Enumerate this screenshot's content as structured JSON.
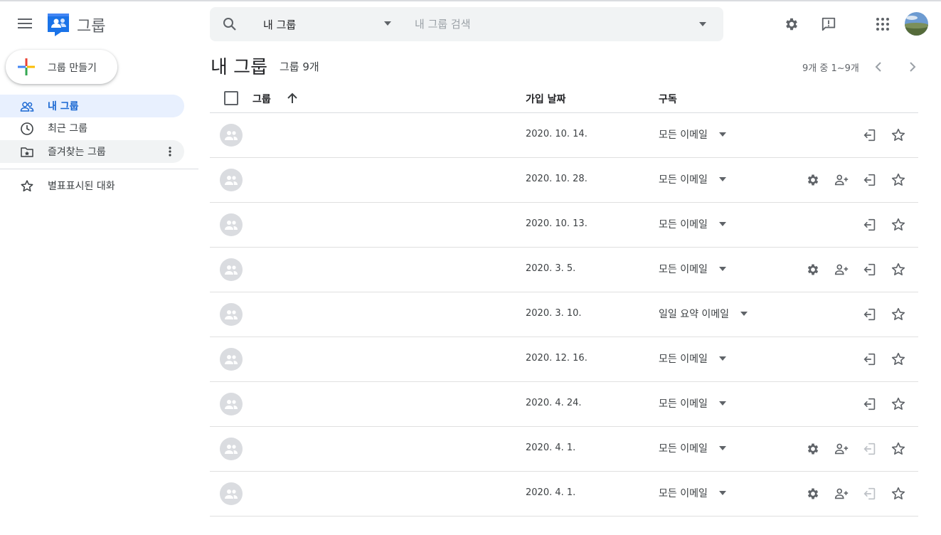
{
  "app": {
    "title": "그룹"
  },
  "search": {
    "scope": "내 그룹",
    "placeholder": "내 그룹 검색"
  },
  "sidebar": {
    "create_label": "그룹 만들기",
    "items": [
      {
        "label": "내 그룹"
      },
      {
        "label": "최근 그룹"
      },
      {
        "label": "즐겨찾는 그룹"
      },
      {
        "label": "별표표시된 대화"
      }
    ]
  },
  "main": {
    "title": "내 그룹",
    "count": "그룹 9개",
    "pager": "9개 중 1~9개",
    "columns": {
      "group": "그룹",
      "date": "가입 날짜",
      "subscription": "구독"
    },
    "rows": [
      {
        "date": "2020. 10. 14.",
        "subscription": "모든 이메일",
        "manage": false,
        "leave_enabled": true
      },
      {
        "date": "2020. 10. 28.",
        "subscription": "모든 이메일",
        "manage": true,
        "leave_enabled": true
      },
      {
        "date": "2020. 10. 13.",
        "subscription": "모든 이메일",
        "manage": false,
        "leave_enabled": true
      },
      {
        "date": "2020. 3. 5.",
        "subscription": "모든 이메일",
        "manage": true,
        "leave_enabled": true
      },
      {
        "date": "2020. 3. 10.",
        "subscription": "일일 요약 이메일",
        "manage": false,
        "leave_enabled": true
      },
      {
        "date": "2020. 12. 16.",
        "subscription": "모든 이메일",
        "manage": false,
        "leave_enabled": true
      },
      {
        "date": "2020. 4. 24.",
        "subscription": "모든 이메일",
        "manage": false,
        "leave_enabled": true
      },
      {
        "date": "2020. 4. 1.",
        "subscription": "모든 이메일",
        "manage": true,
        "leave_enabled": false
      },
      {
        "date": "2020. 4. 1.",
        "subscription": "모든 이메일",
        "manage": true,
        "leave_enabled": false
      }
    ]
  },
  "colors": {
    "accent": "#1967d2",
    "active_bg": "#e8f0fe",
    "icon": "#5f6368",
    "disabled_icon": "#bdc1c6"
  },
  "icons": [
    "menu-icon",
    "groups-logo",
    "search-icon",
    "settings-icon",
    "feedback-icon",
    "apps-icon",
    "avatar",
    "plus-icon",
    "people-icon",
    "clock-icon",
    "star-folder-icon",
    "more-vert-icon",
    "star-icon",
    "chevron-left-icon",
    "chevron-right-icon",
    "arrow-up-icon",
    "group-avatar-icon",
    "dropdown-icon",
    "add-member-icon",
    "leave-icon"
  ]
}
